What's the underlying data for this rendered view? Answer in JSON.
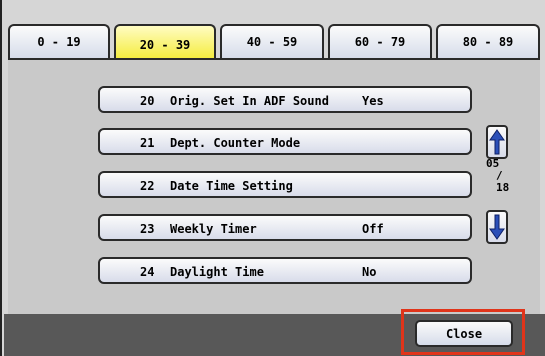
{
  "tabs": [
    {
      "label": "0 - 19",
      "active": false
    },
    {
      "label": "20 - 39",
      "active": true
    },
    {
      "label": "40 - 59",
      "active": false
    },
    {
      "label": "60 - 79",
      "active": false
    },
    {
      "label": "80 - 89",
      "active": false
    }
  ],
  "rows": [
    {
      "num": "20",
      "label": "Orig. Set In ADF Sound",
      "value": "Yes"
    },
    {
      "num": "21",
      "label": "Dept. Counter Mode",
      "value": ""
    },
    {
      "num": "22",
      "label": "Date Time Setting",
      "value": ""
    },
    {
      "num": "23",
      "label": "Weekly Timer",
      "value": "Off"
    },
    {
      "num": "24",
      "label": "Daylight Time",
      "value": "No"
    }
  ],
  "pager": {
    "current": "05",
    "separator": "/",
    "total": "18"
  },
  "footer": {
    "close_label": "Close"
  },
  "colors": {
    "active_tab": "#f3ea28",
    "highlight": "#e0341a",
    "footer_bar": "#585858"
  },
  "icons": {
    "up": "arrow-up-icon",
    "down": "arrow-down-icon"
  }
}
